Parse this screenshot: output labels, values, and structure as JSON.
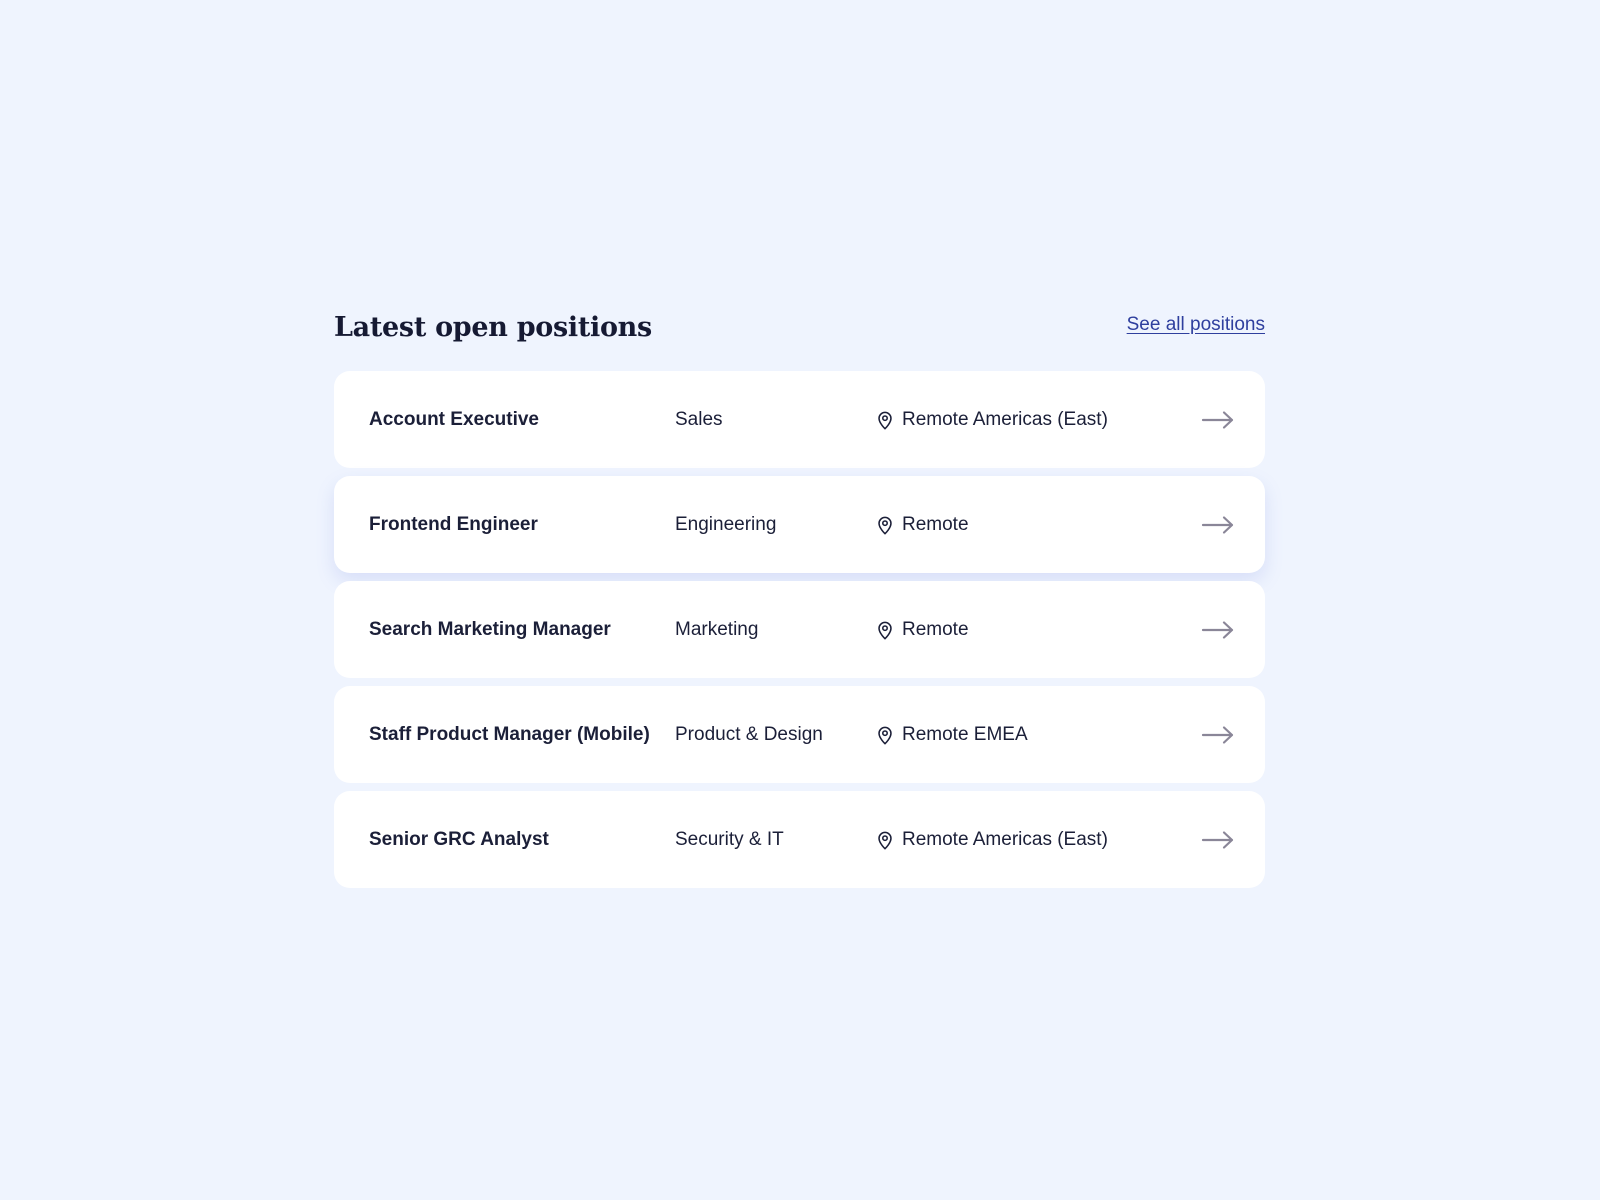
{
  "section": {
    "title": "Latest open positions",
    "see_all_label": "See all positions"
  },
  "positions": [
    {
      "title": "Account Executive",
      "department": "Sales",
      "location": "Remote Americas (East)"
    },
    {
      "title": "Frontend Engineer",
      "department": "Engineering",
      "location": "Remote"
    },
    {
      "title": "Search Marketing Manager",
      "department": "Marketing",
      "location": "Remote"
    },
    {
      "title": "Staff Product Manager (Mobile)",
      "department": "Product & Design",
      "location": "Remote EMEA"
    },
    {
      "title": "Senior GRC Analyst",
      "department": "Security & IT",
      "location": "Remote Americas (East)"
    }
  ],
  "icons": {
    "location": "map-pin-icon",
    "row_action": "arrow-right-icon"
  },
  "colors": {
    "background": "#eff4fe",
    "card": "#ffffff",
    "text": "#1b1f38",
    "link": "#2f3f9e",
    "arrow": "#8a8698"
  }
}
